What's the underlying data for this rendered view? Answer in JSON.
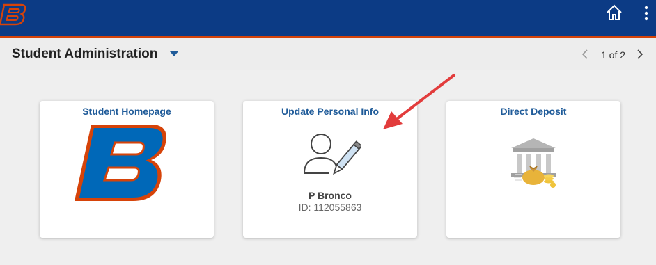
{
  "header": {
    "logo_icon": "bsu-b-logo-icon",
    "home_icon": "home-icon",
    "more_icon": "vertical-dots-icon",
    "colors": {
      "banner": "#0c3b85",
      "accent": "#d64309"
    }
  },
  "pagebar": {
    "title": "Student Administration",
    "caret_icon": "caret-down-icon",
    "page_count": "1 of 2",
    "prev_icon": "chevron-left-icon",
    "next_icon": "chevron-right-icon"
  },
  "tiles": [
    {
      "title": "Student Homepage",
      "icon": "bsu-b-logo-icon"
    },
    {
      "title": "Update Personal Info",
      "icon": "person-edit-icon",
      "name": "P Bronco",
      "id_text": "ID: 112055863"
    },
    {
      "title": "Direct Deposit",
      "icon": "bank-money-icon"
    }
  ],
  "annotation": {
    "icon": "red-arrow-icon",
    "color": "#e23c3c"
  }
}
